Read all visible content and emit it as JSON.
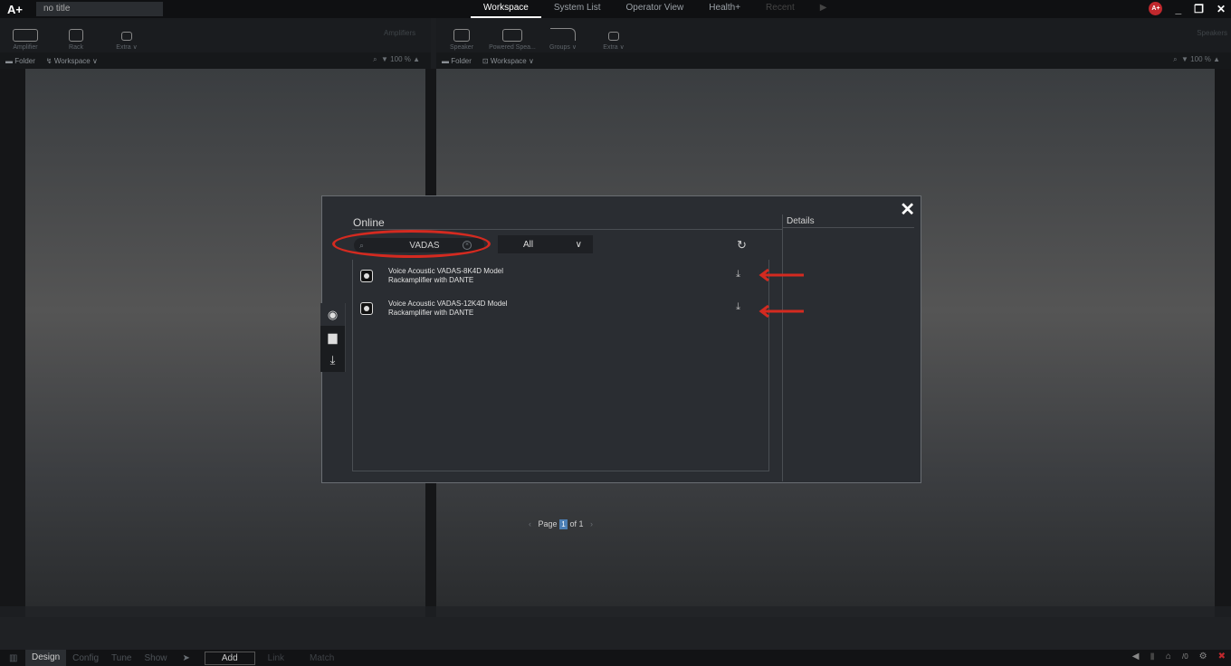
{
  "app": {
    "logo": "A+",
    "document_title": "no title",
    "top_tabs": [
      "Workspace",
      "System List",
      "Operator View",
      "Health+",
      "Recent"
    ],
    "active_tab": "Workspace",
    "user_badge": "A+"
  },
  "left_toolbar": {
    "tools": [
      "Amplifier",
      "Rack",
      "Extra"
    ],
    "section_label": "Amplifiers"
  },
  "right_toolbar": {
    "tools": [
      "Speaker",
      "Powered Spea...",
      "Groups",
      "Extra"
    ],
    "section_label": "Speakers"
  },
  "left_subbar": {
    "folder": "Folder",
    "workspace": "Workspace",
    "zoom": "100 %"
  },
  "right_subbar": {
    "folder": "Folder",
    "workspace": "Workspace",
    "zoom": "100 %"
  },
  "dialog": {
    "title": "Online",
    "details_title": "Details",
    "search": {
      "value": "VADAS"
    },
    "filter": {
      "selected": "All"
    },
    "items": [
      {
        "line1": "Voice Acoustic VADAS-8K4D Model",
        "line2": "Rackamplifier with DANTE"
      },
      {
        "line1": "Voice Acoustic VADAS-12K4D Model",
        "line2": "Rackamplifier with DANTE"
      }
    ],
    "pager": {
      "label": "Page",
      "current": "1",
      "of": "of 1"
    }
  },
  "bottom_bar": {
    "modes": [
      "Design",
      "Config",
      "Tune",
      "Show"
    ],
    "active_mode": "Design",
    "add": "Add",
    "link": "Link",
    "match": "Match",
    "counter": "/0"
  },
  "colors": {
    "highlight": "#d42a20",
    "accent": "#4c7fb5"
  }
}
